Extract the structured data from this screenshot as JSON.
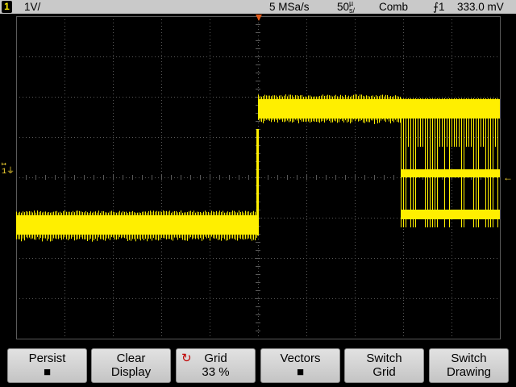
{
  "status": {
    "channel": "1",
    "channel_scale": "1V/",
    "sample_rate": "5 MSa/s",
    "timebase_value": "50",
    "timebase_unit_top": "µ",
    "timebase_unit_bottom": "s/",
    "trigger_mode": "Comb",
    "trigger_source": "1",
    "trigger_level": "333.0 mV"
  },
  "softkeys": [
    {
      "line1": "Persist",
      "line2": "■"
    },
    {
      "line1": "Clear",
      "line2": "Display"
    },
    {
      "line1": "Grid",
      "line2": "33 %"
    },
    {
      "line1": "Vectors",
      "line2": "■"
    },
    {
      "line1": "Switch",
      "line2": "Grid"
    },
    {
      "line1": "Switch",
      "line2": "Drawing"
    }
  ],
  "colors": {
    "trace": "#ffef00",
    "grid": "#5a5a5a",
    "status_bg": "#c9c9c9",
    "softkey_bg": "#d4d4d4",
    "icon_red": "#c00000"
  },
  "markers": {
    "ground_label": "1",
    "trigger_pos": "T"
  }
}
